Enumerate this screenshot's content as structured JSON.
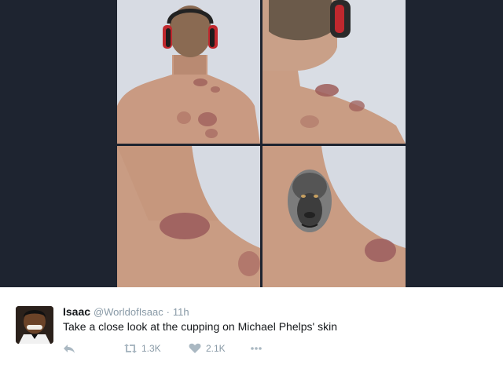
{
  "tweet": {
    "name": "Isaac",
    "handle": "@WorldofIsaac",
    "separator": "·",
    "time": "11h",
    "text": "Take a close look at the cupping on Michael Phelps' skin",
    "retweets": "1.3K",
    "likes": "2.1K"
  },
  "icons": {
    "reply": "reply-icon",
    "retweet": "retweet-icon",
    "like": "heart-icon",
    "more": "more-dots-icon"
  },
  "colors": {
    "media_background": "#1e2430",
    "muted_text": "#8899a6",
    "icon": "#aab8c2"
  }
}
